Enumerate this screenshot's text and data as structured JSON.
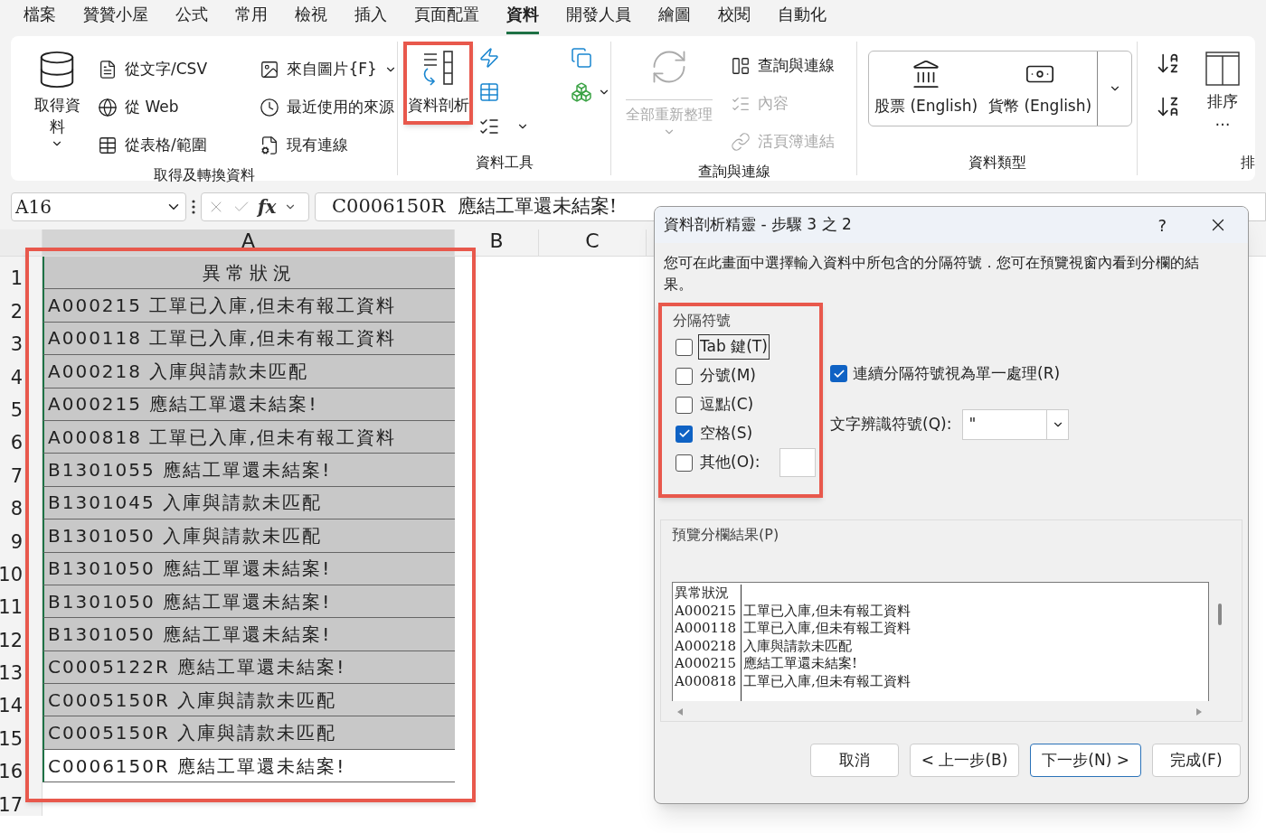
{
  "menu_tabs": [
    {
      "label": "檔案",
      "selected": false
    },
    {
      "label": "贊贊小屋",
      "selected": false
    },
    {
      "label": "公式",
      "selected": false
    },
    {
      "label": "常用",
      "selected": false
    },
    {
      "label": "檢視",
      "selected": false
    },
    {
      "label": "插入",
      "selected": false
    },
    {
      "label": "頁面配置",
      "selected": false
    },
    {
      "label": "資料",
      "selected": true
    },
    {
      "label": "開發人員",
      "selected": false
    },
    {
      "label": "繪圖",
      "selected": false
    },
    {
      "label": "校閱",
      "selected": false
    },
    {
      "label": "自動化",
      "selected": false
    }
  ],
  "ribbon": {
    "get_data": {
      "big_button": {
        "label": "取得資料"
      },
      "small_buttons": [
        {
          "kind": "text-file",
          "label": "從文字/CSV",
          "caret": false
        },
        {
          "kind": "web",
          "label": "從 Web",
          "caret": false
        },
        {
          "kind": "table",
          "label": "從表格/範圍",
          "caret": false
        },
        {
          "kind": "image",
          "label": "來自圖片{F}",
          "caret": true
        },
        {
          "kind": "recent",
          "label": "最近使用的來源",
          "caret": false
        },
        {
          "kind": "connection",
          "label": "現有連線",
          "caret": false
        }
      ],
      "group_label": "取得及轉換資料"
    },
    "data_tools": {
      "big_button": {
        "label": "資料剖析",
        "highlighted": true
      },
      "group_label": "資料工具"
    },
    "queries": {
      "big_button": {
        "label": "全部重新整理",
        "disabled": true
      },
      "small_buttons": [
        {
          "kind": "queries",
          "label": "查詢與連線",
          "disabled": false
        },
        {
          "kind": "properties",
          "label": "內容",
          "disabled": true
        },
        {
          "kind": "links",
          "label": "活頁簿連結",
          "disabled": true
        }
      ],
      "group_label": "查詢與連線"
    },
    "data_types": {
      "items": [
        {
          "kind": "bank",
          "label": "股票 (English)"
        },
        {
          "kind": "money",
          "label": "貨幣 (English)"
        }
      ],
      "group_label": "資料類型"
    },
    "sort": {
      "label": "排序",
      "more": "…",
      "group_label": "排"
    }
  },
  "formula_bar": {
    "name_box": "A16",
    "fx": "fx",
    "value": "C0006150R  應結工單還未結案!"
  },
  "sheet": {
    "columns": [
      "A",
      "B",
      "C"
    ],
    "highlighted": true,
    "rows": [
      {
        "number": "1",
        "cell": "異常狀況",
        "header": true,
        "selected": true
      },
      {
        "number": "2",
        "cell": "A000215 工單已入庫,但未有報工資料",
        "header": false,
        "selected": true
      },
      {
        "number": "3",
        "cell": "A000118 工單已入庫,但未有報工資料",
        "header": false,
        "selected": true
      },
      {
        "number": "4",
        "cell": "A000218 入庫與請款未匹配",
        "header": false,
        "selected": true
      },
      {
        "number": "5",
        "cell": "A000215 應結工單還未結案!",
        "header": false,
        "selected": true
      },
      {
        "number": "6",
        "cell": "A000818 工單已入庫,但未有報工資料",
        "header": false,
        "selected": true
      },
      {
        "number": "7",
        "cell": "B1301055 應結工單還未結案!",
        "header": false,
        "selected": true
      },
      {
        "number": "8",
        "cell": "B1301045 入庫與請款未匹配",
        "header": false,
        "selected": true
      },
      {
        "number": "9",
        "cell": "B1301050 入庫與請款未匹配",
        "header": false,
        "selected": true
      },
      {
        "number": "10",
        "cell": "B1301050 應結工單還未結案!",
        "header": false,
        "selected": true
      },
      {
        "number": "11",
        "cell": "B1301050 應結工單還未結案!",
        "header": false,
        "selected": true
      },
      {
        "number": "12",
        "cell": "B1301050 應結工單還未結案!",
        "header": false,
        "selected": true
      },
      {
        "number": "13",
        "cell": "C0005122R 應結工單還未結案!",
        "header": false,
        "selected": true
      },
      {
        "number": "14",
        "cell": "C0005150R 入庫與請款未匹配",
        "header": false,
        "selected": true
      },
      {
        "number": "15",
        "cell": "C0005150R 入庫與請款未匹配",
        "header": false,
        "selected": true
      },
      {
        "number": "16",
        "cell": "C0006150R 應結工單還未結案!",
        "header": false,
        "selected": false
      },
      {
        "number": "17"
      }
    ]
  },
  "dialog": {
    "title": "資料剖析精靈 - 步驟 3 之 2",
    "help": "?",
    "description": "您可在此畫面中選擇輸入資料中所包含的分隔符號．您可在預覽視窗內看到分欄的結果。",
    "delimiters": {
      "label": "分隔符號",
      "highlighted": true,
      "options": [
        {
          "label": "Tab 鍵(T)",
          "checked": false,
          "focused": true,
          "kind": "plain"
        },
        {
          "label": "分號(M)",
          "checked": false,
          "focused": false,
          "kind": "plain"
        },
        {
          "label": "逗點(C)",
          "checked": false,
          "focused": false,
          "kind": "plain"
        },
        {
          "label": "空格(S)",
          "checked": true,
          "focused": false,
          "kind": "plain"
        },
        {
          "label": "其他(O):",
          "checked": false,
          "focused": false,
          "kind": "other"
        }
      ]
    },
    "consecutive": {
      "label": "連續分隔符號視為單一處理(R)",
      "checked": true
    },
    "qualifier": {
      "label": "文字辨識符號(Q):",
      "value": "\""
    },
    "preview": {
      "label": "預覽分欄結果(P)",
      "rows": [
        [
          "異常狀況"
        ],
        [
          "A000215",
          "工單已入庫,但未有報工資料"
        ],
        [
          "A000118",
          "工單已入庫,但未有報工資料"
        ],
        [
          "A000218",
          "入庫與請款未匹配"
        ],
        [
          "A000215",
          "應結工單還未結案!"
        ],
        [
          "A000818",
          "工單已入庫,但未有報工資料"
        ]
      ]
    },
    "buttons": [
      {
        "label": "取消",
        "default": false
      },
      {
        "label": "< 上一步(B)",
        "default": false
      },
      {
        "label": "下一步(N) >",
        "default": true
      },
      {
        "label": "完成(F)",
        "default": false
      }
    ]
  }
}
